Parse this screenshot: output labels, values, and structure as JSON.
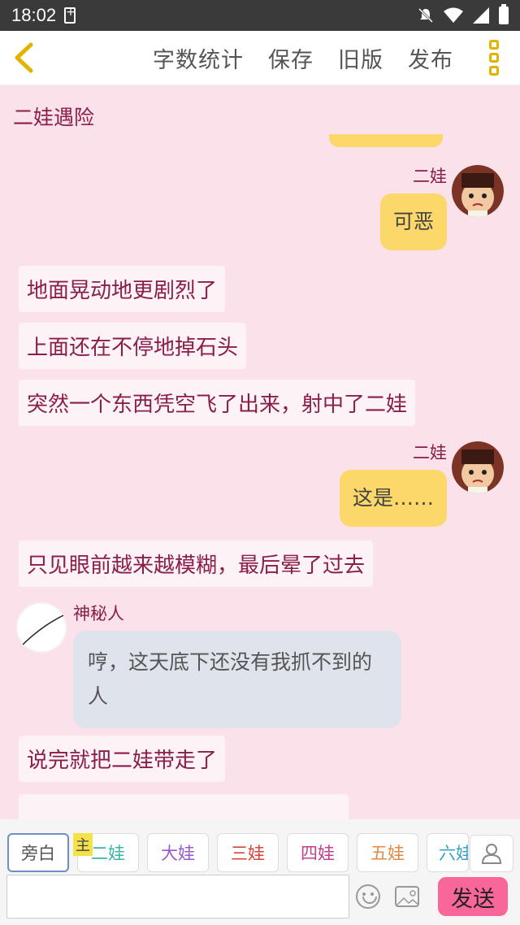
{
  "status_bar": {
    "time": "18:02"
  },
  "toolbar": {
    "word_count": "字数统计",
    "save": "保存",
    "old_version": "旧版",
    "publish": "发布"
  },
  "chat": {
    "title": "二娃遇险",
    "messages": [
      {
        "type": "character",
        "name": "二娃",
        "text": "可恶"
      },
      {
        "type": "narration",
        "text": "地面晃动地更剧烈了"
      },
      {
        "type": "narration",
        "text": "上面还在不停地掉石头"
      },
      {
        "type": "narration",
        "text": "突然一个东西凭空飞了出来，射中了二娃"
      },
      {
        "type": "character",
        "name": "二娃",
        "text": "这是……"
      },
      {
        "type": "narration",
        "text": "只见眼前越来越模糊，最后晕了过去"
      },
      {
        "type": "character",
        "name": "神秘人",
        "text": "哼，这天底下还没有我抓不到的人"
      },
      {
        "type": "narration",
        "text": "说完就把二娃带走了"
      }
    ]
  },
  "characters": {
    "main_tag": "主",
    "items": [
      {
        "label": "旁白",
        "color": "#555555"
      },
      {
        "label": "二娃",
        "color": "#3bb5a8"
      },
      {
        "label": "大娃",
        "color": "#9b59d0"
      },
      {
        "label": "三娃",
        "color": "#d9443a"
      },
      {
        "label": "四娃",
        "color": "#c0408f"
      },
      {
        "label": "五娃",
        "color": "#e08a45"
      },
      {
        "label": "六娃",
        "color": "#3aa0c8"
      }
    ]
  },
  "input": {
    "value": "",
    "placeholder": ""
  },
  "send_label": "发送"
}
